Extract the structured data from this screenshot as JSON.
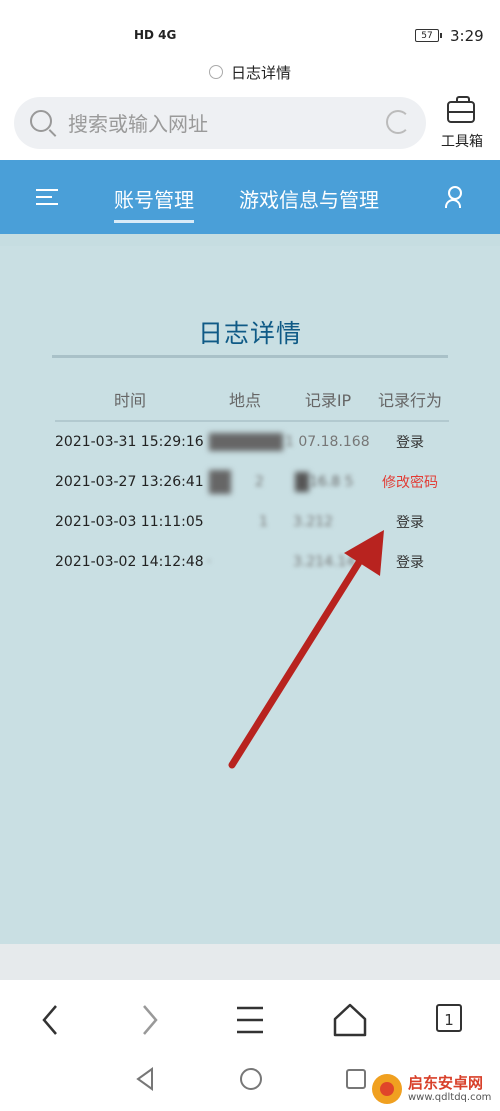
{
  "status": {
    "signal": "HD 4G",
    "battery": "57",
    "time": "3:29"
  },
  "page_title": "日志详情",
  "search": {
    "placeholder": "搜索或输入网址"
  },
  "toolbox": {
    "label": "工具箱"
  },
  "nav": {
    "tab_account": "账号管理",
    "tab_game": "游戏信息与管理"
  },
  "log": {
    "title": "日志详情",
    "headers": [
      "时间",
      "地点",
      "记录IP",
      "记录行为"
    ],
    "rows": [
      {
        "time": "2021-03-31 15:29:16",
        "ip_partial": "07.18.168",
        "action": "登录"
      },
      {
        "time": "2021-03-27 13:26:41",
        "ip_partial": "16.8",
        "action": "修改密码"
      },
      {
        "time": "2021-03-03 11:11:05",
        "ip_partial": "3.212",
        "action": "登录"
      },
      {
        "time": "2021-03-02 14:12:48",
        "ip_partial": "3.214.14",
        "action": "登录"
      }
    ]
  },
  "bottom_nav": {
    "tab_count": "1"
  },
  "watermark": {
    "name": "启东安卓网",
    "url": "www.qdltdq.com"
  },
  "colors": {
    "nav": "#4a9fd8",
    "panel": "#c9dfe3",
    "title": "#0f5a86",
    "warn": "#e23c35",
    "arrow": "#b8231f"
  }
}
